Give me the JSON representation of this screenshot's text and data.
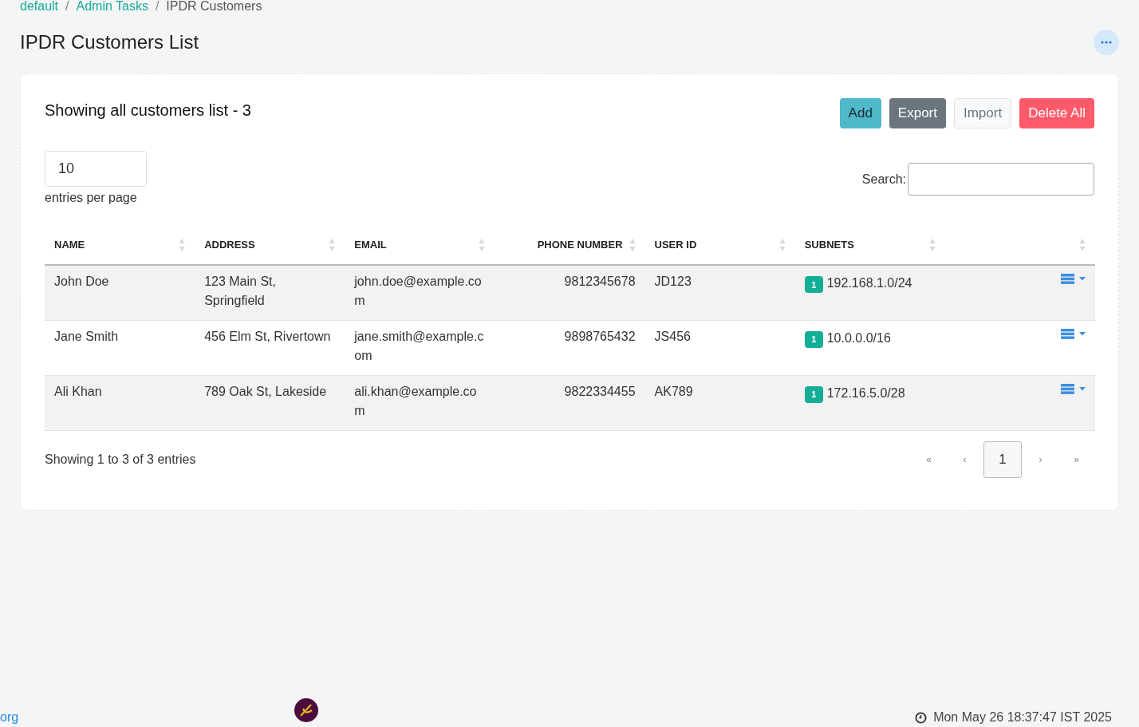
{
  "breadcrumb": {
    "separator": "/",
    "items": [
      {
        "label": "default",
        "link": true
      },
      {
        "label": "Admin Tasks",
        "link": true
      },
      {
        "label": "IPDR Customers",
        "link": false
      }
    ]
  },
  "page_title": "IPDR Customers List",
  "card": {
    "title": "Showing all customers list - 3",
    "buttons": [
      {
        "label": "Add",
        "kind": "info"
      },
      {
        "label": "Export",
        "kind": "secondary"
      },
      {
        "label": "Import",
        "kind": "light"
      },
      {
        "label": "Delete All",
        "kind": "danger"
      }
    ],
    "page_size": {
      "value": "10",
      "label": "entries per page"
    },
    "search": {
      "label": "Search:"
    },
    "table": {
      "columns": [
        {
          "label": "NAME",
          "kind": "text"
        },
        {
          "label": "ADDRESS",
          "kind": "text"
        },
        {
          "label": "EMAIL",
          "kind": "text"
        },
        {
          "label": "PHONE NUMBER",
          "kind": "number"
        },
        {
          "label": "USER ID",
          "kind": "text"
        },
        {
          "label": "SUBNETS",
          "kind": "text"
        },
        {
          "kind": "actions"
        }
      ],
      "rows": [
        {
          "name": "John Doe",
          "address": "123 Main St, Springfield",
          "email": "john.doe@example.com",
          "phone": "9812345678",
          "user_id": "JD123",
          "subnet_count": "1",
          "subnet": "192.168.1.0/24"
        },
        {
          "name": "Jane Smith",
          "address": "456 Elm St, Rivertown",
          "email": "jane.smith@example.com",
          "phone": "9898765432",
          "user_id": "JS456",
          "subnet_count": "1",
          "subnet": "10.0.0.0/16"
        },
        {
          "name": "Ali Khan",
          "address": "789 Oak St, Lakeside",
          "email": "ali.khan@example.com",
          "phone": "9822334455",
          "user_id": "AK789",
          "subnet_count": "1",
          "subnet": "172.16.5.0/28"
        }
      ]
    },
    "info": "Showing 1 to 3 of 3 entries",
    "pagination": [
      {
        "label": "«",
        "selected": false
      },
      {
        "label": "‹",
        "selected": false
      },
      {
        "label": "1",
        "selected": true
      },
      {
        "label": "›",
        "selected": false
      },
      {
        "label": "»",
        "selected": false
      }
    ]
  },
  "footer": {
    "link": "org",
    "timestamp": "Mon May 26 18:37:47 IST 2025"
  }
}
